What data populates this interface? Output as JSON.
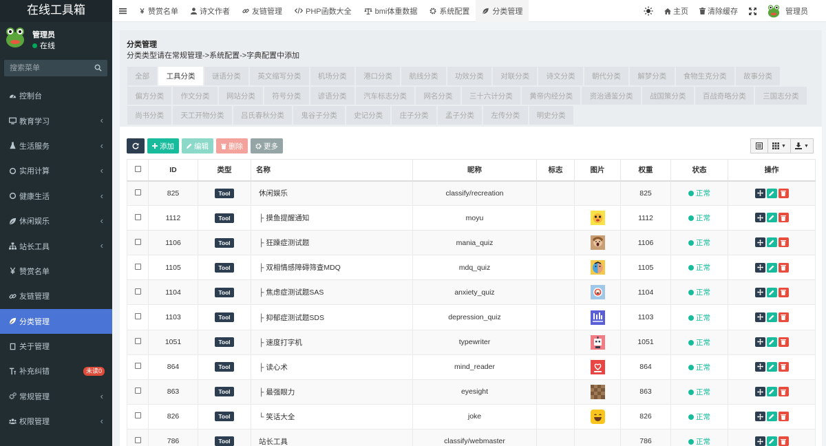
{
  "brand": "在线工具箱",
  "user": {
    "name": "管理员",
    "status": "在线"
  },
  "search": {
    "placeholder": "搜索菜单"
  },
  "menu": [
    {
      "label": "控制台",
      "icon": "dashboard-icon",
      "chevron": false,
      "active": false
    },
    {
      "label": "教育学习",
      "icon": "monitor-icon",
      "chevron": true,
      "active": false
    },
    {
      "label": "生活服务",
      "icon": "flask-icon",
      "chevron": true,
      "active": false
    },
    {
      "label": "实用计算",
      "icon": "circle-icon",
      "chevron": true,
      "active": false
    },
    {
      "label": "健康生活",
      "icon": "circle-icon",
      "chevron": true,
      "active": false
    },
    {
      "label": "休闲娱乐",
      "icon": "leaf-icon",
      "chevron": true,
      "active": false
    },
    {
      "label": "站长工具",
      "icon": "sitemap-icon",
      "chevron": true,
      "active": false
    },
    {
      "label": "赞赏名单",
      "icon": "yen-icon",
      "chevron": false,
      "active": false
    },
    {
      "label": "友链管理",
      "icon": "link-icon",
      "chevron": false,
      "active": false
    },
    {
      "label": "分类管理",
      "icon": "leaf-icon",
      "chevron": false,
      "active": true
    },
    {
      "label": "关于管理",
      "icon": "square-icon",
      "chevron": false,
      "active": false
    },
    {
      "label": "补充纠错",
      "icon": "text-cursor-icon",
      "chevron": false,
      "active": false,
      "badge": "未读0"
    },
    {
      "label": "常规管理",
      "icon": "cogs-icon",
      "chevron": true,
      "active": false
    },
    {
      "label": "权限管理",
      "icon": "group-icon",
      "chevron": true,
      "active": false
    }
  ],
  "topnav": [
    {
      "label": "赞赏名单",
      "icon": "yen-icon",
      "active": false
    },
    {
      "label": "诗文作者",
      "icon": "user-icon",
      "active": false
    },
    {
      "label": "友链管理",
      "icon": "link-icon",
      "active": false
    },
    {
      "label": "PHP函数大全",
      "icon": "code-icon",
      "active": false
    },
    {
      "label": "bmi体重数据",
      "icon": "balance-icon",
      "active": false
    },
    {
      "label": "系统配置",
      "icon": "gear-icon",
      "active": false
    },
    {
      "label": "分类管理",
      "icon": "leaf-icon",
      "active": true
    }
  ],
  "top_right": {
    "home": "主页",
    "clear_cache": "清除缓存",
    "admin": "管理员"
  },
  "page": {
    "title": "分类管理",
    "desc": "分类类型请在常规管理->系统配置->字典配置中添加"
  },
  "category_tabs": [
    "全部",
    "工具分类",
    "谜语分类",
    "英文缩写分类",
    "机场分类",
    "港口分类",
    "航线分类",
    "功效分类",
    "对联分类",
    "诗文分类",
    "朝代分类",
    "解梦分类",
    "食物生克分类",
    "故事分类",
    "偏方分类",
    "作文分类",
    "网站分类",
    "符号分类",
    "谚语分类",
    "汽车标志分类",
    "网名分类",
    "三十六计分类",
    "黄帝内经分类",
    "资治通鉴分类",
    "战国策分类",
    "百战奇略分类",
    "三国志分类",
    "尚书分类",
    "天工开物分类",
    "吕氏春秋分类",
    "鬼谷子分类",
    "史记分类",
    "庄子分类",
    "孟子分类",
    "左传分类",
    "明史分类"
  ],
  "active_tab_index": 1,
  "toolbar": {
    "add": "添加",
    "edit": "编辑",
    "delete": "删除",
    "more": "更多"
  },
  "table": {
    "headers": {
      "id": "ID",
      "type": "类型",
      "name": "名称",
      "nickname": "昵称",
      "flag": "标志",
      "image": "图片",
      "weight": "权重",
      "status": "状态",
      "actions": "操作"
    },
    "rows": [
      {
        "id": "825",
        "type": "Tool",
        "name": "休闲娱乐",
        "nickname": "classify/recreation",
        "image": "",
        "weight": "825",
        "status": "正常"
      },
      {
        "id": "1112",
        "type": "Tool",
        "name": "├ 摸鱼提醒通知",
        "nickname": "moyu",
        "image": "yellow-face-thumbnail",
        "weight": "1112",
        "status": "正常"
      },
      {
        "id": "1106",
        "type": "Tool",
        "name": "├ 狂躁症测试题",
        "nickname": "mania_quiz",
        "image": "screaming-face-thumbnail",
        "weight": "1106",
        "status": "正常"
      },
      {
        "id": "1105",
        "type": "Tool",
        "name": "├ 双相情感障碍筛查MDQ",
        "nickname": "mdq_quiz",
        "image": "split-face-thumbnail",
        "weight": "1105",
        "status": "正常"
      },
      {
        "id": "1104",
        "type": "Tool",
        "name": "├ 焦虑症测试题SAS",
        "nickname": "anxiety_quiz",
        "image": "anxious-face-thumbnail",
        "weight": "1104",
        "status": "正常"
      },
      {
        "id": "1103",
        "type": "Tool",
        "name": "├ 抑郁症测试题SDS",
        "nickname": "depression_quiz",
        "image": "purple-thumbnail",
        "weight": "1103",
        "status": "正常"
      },
      {
        "id": "1051",
        "type": "Tool",
        "name": "├ 速度打字机",
        "nickname": "typewriter",
        "image": "robot-thumbnail",
        "weight": "1051",
        "status": "正常"
      },
      {
        "id": "864",
        "type": "Tool",
        "name": "├ 读心术",
        "nickname": "mind_reader",
        "image": "heart-thumbnail",
        "weight": "864",
        "status": "正常"
      },
      {
        "id": "863",
        "type": "Tool",
        "name": "├ 最强眼力",
        "nickname": "eyesight",
        "image": "mosaic-thumbnail",
        "weight": "863",
        "status": "正常"
      },
      {
        "id": "826",
        "type": "Tool",
        "name": "└ 笑话大全",
        "nickname": "joke",
        "image": "laughing-face-thumbnail",
        "weight": "826",
        "status": "正常"
      },
      {
        "id": "786",
        "type": "Tool",
        "name": "站长工具",
        "nickname": "classify/webmaster",
        "image": "",
        "weight": "786",
        "status": "正常"
      }
    ]
  },
  "colors": {
    "sidebar": "#222d32",
    "active_menu": "#4a74d6",
    "primary": "#18bc9c",
    "danger": "#e74c3c",
    "dark": "#2c3e50"
  }
}
